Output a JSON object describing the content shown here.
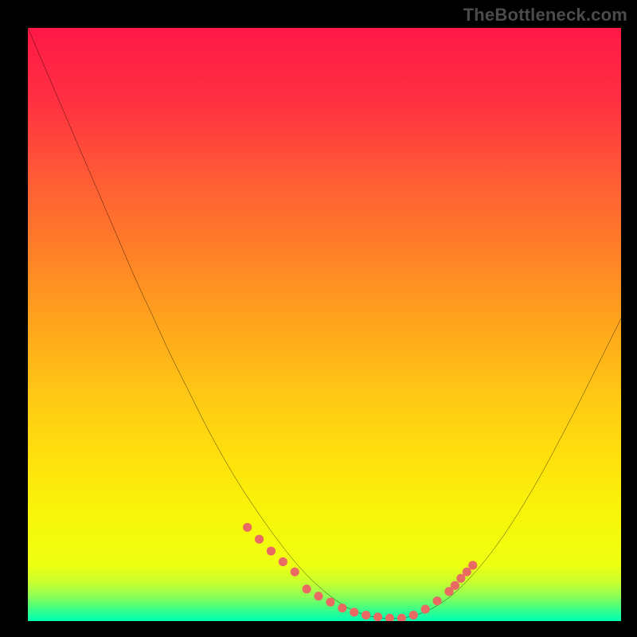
{
  "watermark": "TheBottleneck.com",
  "chart_data": {
    "type": "line",
    "title": "",
    "xlabel": "",
    "ylabel": "",
    "xlim": [
      0,
      100
    ],
    "ylim": [
      0,
      100
    ],
    "axes_visible": false,
    "grid": false,
    "background_gradient": {
      "stops": [
        {
          "offset": 0.0,
          "color": "#ff1846"
        },
        {
          "offset": 0.12,
          "color": "#ff2f42"
        },
        {
          "offset": 0.25,
          "color": "#ff5a36"
        },
        {
          "offset": 0.38,
          "color": "#ff8127"
        },
        {
          "offset": 0.5,
          "color": "#ffa51c"
        },
        {
          "offset": 0.62,
          "color": "#ffc814"
        },
        {
          "offset": 0.74,
          "color": "#ffe40c"
        },
        {
          "offset": 0.83,
          "color": "#f7f70a"
        },
        {
          "offset": 0.905,
          "color": "#eeff12"
        },
        {
          "offset": 0.935,
          "color": "#c7ff2f"
        },
        {
          "offset": 0.958,
          "color": "#8dff55"
        },
        {
          "offset": 0.976,
          "color": "#4bff7c"
        },
        {
          "offset": 0.992,
          "color": "#17ffa4"
        },
        {
          "offset": 1.0,
          "color": "#00ffb0"
        }
      ]
    },
    "series": [
      {
        "name": "bottleneck-curve",
        "color": "#000000",
        "x": [
          0,
          3,
          6,
          9,
          12,
          15,
          18,
          21,
          24,
          27,
          30,
          33,
          36,
          39,
          42,
          45,
          48,
          51,
          54,
          57,
          60,
          63,
          66,
          69,
          72,
          75,
          78,
          81,
          84,
          87,
          90,
          93,
          96,
          100
        ],
        "y": [
          100,
          93,
          86,
          79,
          72,
          65,
          58,
          51.5,
          45,
          39,
          33,
          27.5,
          22.5,
          18,
          13.8,
          10,
          6.8,
          4.2,
          2.2,
          1.0,
          0.5,
          0.5,
          1.2,
          2.6,
          4.8,
          7.8,
          11.4,
          15.6,
          20.4,
          25.6,
          31.2,
          37.0,
          43.0,
          51.0
        ]
      },
      {
        "name": "marker-dots",
        "color": "#e96a63",
        "type": "scatter",
        "x": [
          37,
          39,
          41,
          43,
          45,
          47,
          49,
          51,
          53,
          55,
          57,
          59,
          61,
          63,
          65,
          67,
          69,
          71,
          72,
          73,
          74,
          75
        ],
        "y": [
          15.8,
          13.8,
          11.8,
          10.0,
          8.3,
          5.4,
          4.2,
          3.2,
          2.2,
          1.5,
          1.0,
          0.7,
          0.5,
          0.5,
          1.0,
          2.0,
          3.4,
          5.0,
          6.0,
          7.2,
          8.3,
          9.4
        ]
      }
    ]
  }
}
